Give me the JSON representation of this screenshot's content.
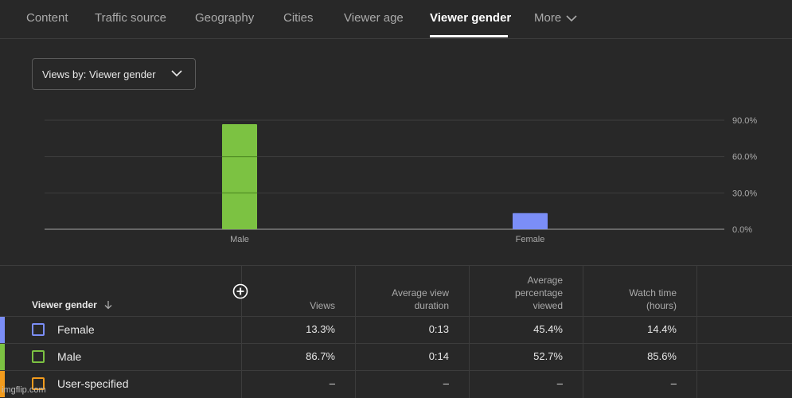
{
  "tabs": [
    {
      "label": "Content"
    },
    {
      "label": "Traffic source"
    },
    {
      "label": "Geography"
    },
    {
      "label": "Cities"
    },
    {
      "label": "Viewer age"
    },
    {
      "label": "Viewer gender",
      "active": true
    },
    {
      "label": "More"
    }
  ],
  "views_select": {
    "label": "Views by: Viewer gender"
  },
  "chart_data": {
    "type": "bar",
    "categories": [
      "Male",
      "Female"
    ],
    "values": [
      86.7,
      13.3
    ],
    "colors": [
      "#7cc242",
      "#7b8ef7"
    ],
    "y_ticks": [
      "90.0%",
      "60.0%",
      "30.0%",
      "0.0%"
    ],
    "ylim": [
      0,
      90
    ],
    "grid": true
  },
  "table": {
    "headers": {
      "gender": "Viewer gender",
      "views": "Views",
      "avg_duration": [
        "Average view",
        "duration"
      ],
      "avg_percentage": [
        "Average",
        "percentage",
        "viewed"
      ],
      "watch_time": [
        "Watch time",
        "(hours)"
      ]
    },
    "rows": [
      {
        "label": "Female",
        "color": "#7b8ef7",
        "views": "13.3%",
        "avg_duration": "0:13",
        "avg_percentage": "45.4%",
        "watch_time": "14.4%"
      },
      {
        "label": "Male",
        "color": "#7cc242",
        "views": "86.7%",
        "avg_duration": "0:14",
        "avg_percentage": "52.7%",
        "watch_time": "85.6%"
      },
      {
        "label": "User-specified",
        "color": "#f29b1d",
        "views": "–",
        "avg_duration": "–",
        "avg_percentage": "–",
        "watch_time": "–"
      }
    ]
  },
  "watermark": "imgflip.com"
}
